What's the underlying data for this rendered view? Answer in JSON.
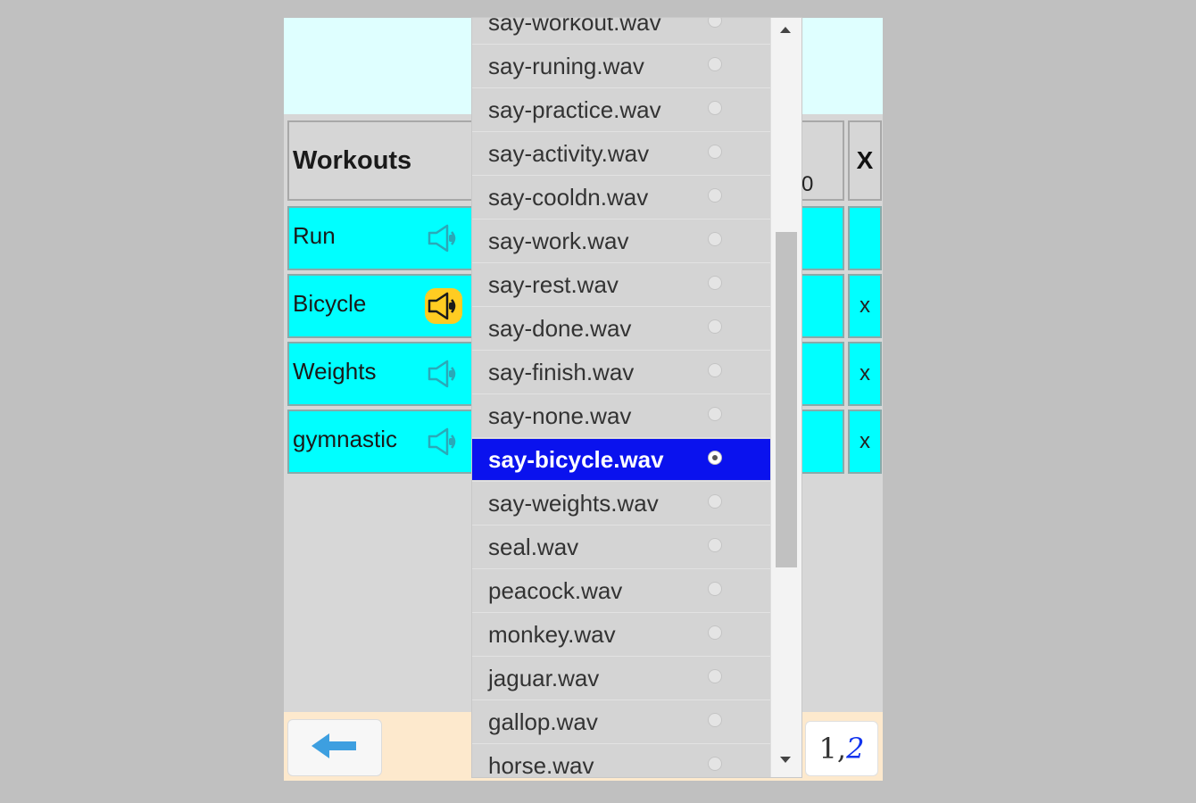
{
  "table": {
    "header": {
      "title": "Workouts",
      "mid_text": "0",
      "delete_header": "X"
    },
    "rows": [
      {
        "name": "Run",
        "delete": "",
        "speaker_active": false
      },
      {
        "name": "Bicycle",
        "delete": "x",
        "speaker_active": true
      },
      {
        "name": "Weights",
        "delete": "x",
        "speaker_active": false
      },
      {
        "name": "gymnastic",
        "delete": "x",
        "speaker_active": false
      }
    ]
  },
  "dropdown": {
    "selected": "say-bicycle.wav",
    "options": [
      "say-workout.wav",
      "say-runing.wav",
      "say-practice.wav",
      "say-activity.wav",
      "say-cooldn.wav",
      "say-work.wav",
      "say-rest.wav",
      "say-done.wav",
      "say-finish.wav",
      "say-none.wav",
      "say-bicycle.wav",
      "say-weights.wav",
      "seal.wav",
      "peacock.wav",
      "monkey.wav",
      "jaguar.wav",
      "gallop.wav",
      "horse.wav"
    ]
  },
  "footer": {
    "back_icon": "arrow-left-icon",
    "page_first": "1",
    "page_sep": ",",
    "page_second": "2"
  },
  "colors": {
    "row_bg": "#00ffff",
    "selected_bg": "#0a12ee",
    "active_speaker": "#ffcc22",
    "top_band": "#dfffff",
    "footer_band": "#fde9cd"
  }
}
